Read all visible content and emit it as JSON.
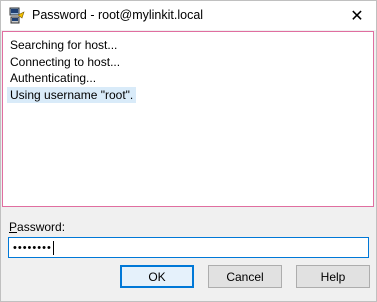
{
  "window": {
    "title": "Password - root@mylinkit.local",
    "app_icon": "putty-icon",
    "close_glyph": "✕"
  },
  "log": {
    "lines": [
      "Searching for host...",
      "Connecting to host...",
      "Authenticating...",
      "Using username \"root\"."
    ],
    "selected_index": 3
  },
  "password": {
    "label_mnemonic": "P",
    "label_rest": "assword:",
    "value_masked": "••••••••"
  },
  "buttons": {
    "ok": "OK",
    "cancel": "Cancel",
    "help": "Help"
  },
  "colors": {
    "focus_border": "#0078d7",
    "log_border": "#e06ea0",
    "selection": "#d9ebf9"
  }
}
